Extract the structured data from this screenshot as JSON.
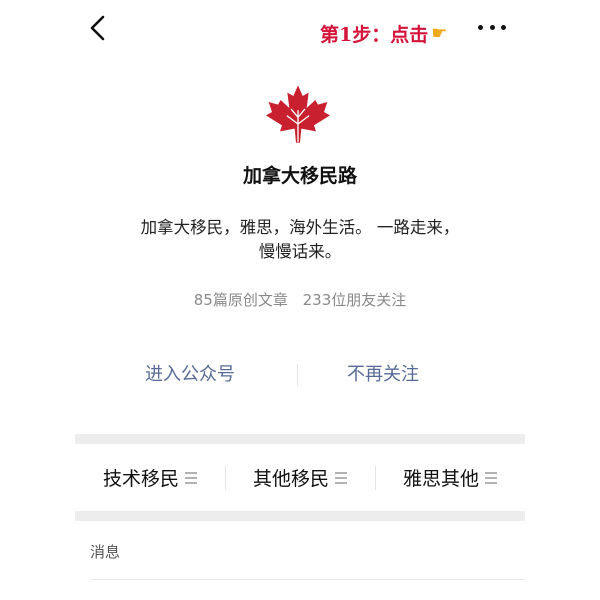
{
  "top_bar": {
    "back_icon": "chevron-left-icon",
    "annotation": "第1步：点击",
    "annotation_icon": "pointing-hand-icon",
    "annotation_icon_glyph": "☛",
    "more_icon": "more-dots-icon"
  },
  "account": {
    "logo_icon": "maple-leaf-icon",
    "name": "加拿大移民路",
    "description": "加拿大移民，雅思，海外生活。 一路走来， 慢慢话来。",
    "stats": {
      "articles": "85篇原创文章",
      "friends": "233位朋友关注"
    }
  },
  "actions": {
    "enter_label": "进入公众号",
    "unfollow_label": "不再关注"
  },
  "menu": {
    "items": [
      {
        "label": "技术移民",
        "icon": "menu-lines-icon"
      },
      {
        "label": "其他移民",
        "icon": "menu-lines-icon"
      },
      {
        "label": "雅思其他",
        "icon": "menu-lines-icon"
      }
    ]
  },
  "messages": {
    "label": "消息"
  },
  "colors": {
    "link": "#576b95",
    "annotation": "#d4143a",
    "logo": "#c8202f",
    "separator": "#ededed"
  }
}
